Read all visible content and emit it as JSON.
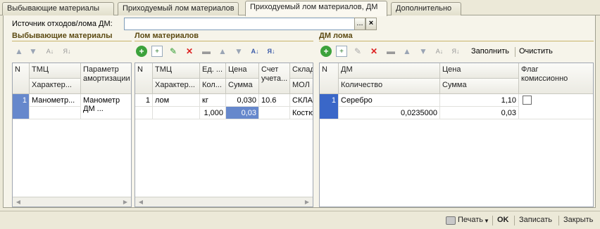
{
  "tabs": [
    {
      "label": "Выбывающие материалы"
    },
    {
      "label": "Приходуемый лом материалов"
    },
    {
      "label": "Приходуемый лом материалов, ДМ"
    },
    {
      "label": "Дополнительно"
    }
  ],
  "source": {
    "label": "Источник отходов/лома ДМ:",
    "value": "",
    "select_btn": "...",
    "clear_btn": "×"
  },
  "sections": {
    "left": {
      "title": "Выбывающие материалы"
    },
    "middle": {
      "title": "Лом материалов"
    },
    "right": {
      "title": "ДМ лома"
    }
  },
  "right_toolbar": {
    "fill": "Заполнить",
    "clear": "Очистить"
  },
  "left_grid": {
    "headers": {
      "n": "N",
      "tmc": "ТМЦ",
      "char": "Характер...",
      "param1": "Параметр",
      "param2": "амортизации"
    },
    "rows": [
      {
        "n": "1",
        "tmc": "Манометр...",
        "param1": "Манометр",
        "param2": "ДМ ..."
      }
    ]
  },
  "mid_grid": {
    "headers": {
      "n": "N",
      "tmc": "ТМЦ",
      "char": "Характер...",
      "unit": "Ед. ...",
      "qty": "Кол...",
      "price": "Цена",
      "sum": "Сумма",
      "acc": "Счет",
      "acc2": "учета...",
      "warehouse": "Склад",
      "mol": "МОЛ"
    },
    "rows": [
      {
        "n": "1",
        "tmc": "лом",
        "unit": "кг",
        "price": "0,030",
        "acc": "10.6",
        "warehouse": "СКЛАД",
        "qty": "1,000",
        "sum": "0,03",
        "mol": "Костю..."
      }
    ]
  },
  "right_grid": {
    "headers": {
      "n": "N",
      "dm": "ДМ",
      "qty": "Количество",
      "price": "Цена",
      "sum": "Сумма",
      "flag1": "Флаг",
      "flag2": "комиссионно"
    },
    "rows": [
      {
        "n": "1",
        "dm": "Серебро",
        "price": "1,10",
        "qty": "0,0235000",
        "sum": "0,03",
        "flag": false
      }
    ]
  },
  "bottom": {
    "print": "Печать",
    "ok": "OK",
    "save": "Записать",
    "close": "Закрыть"
  }
}
